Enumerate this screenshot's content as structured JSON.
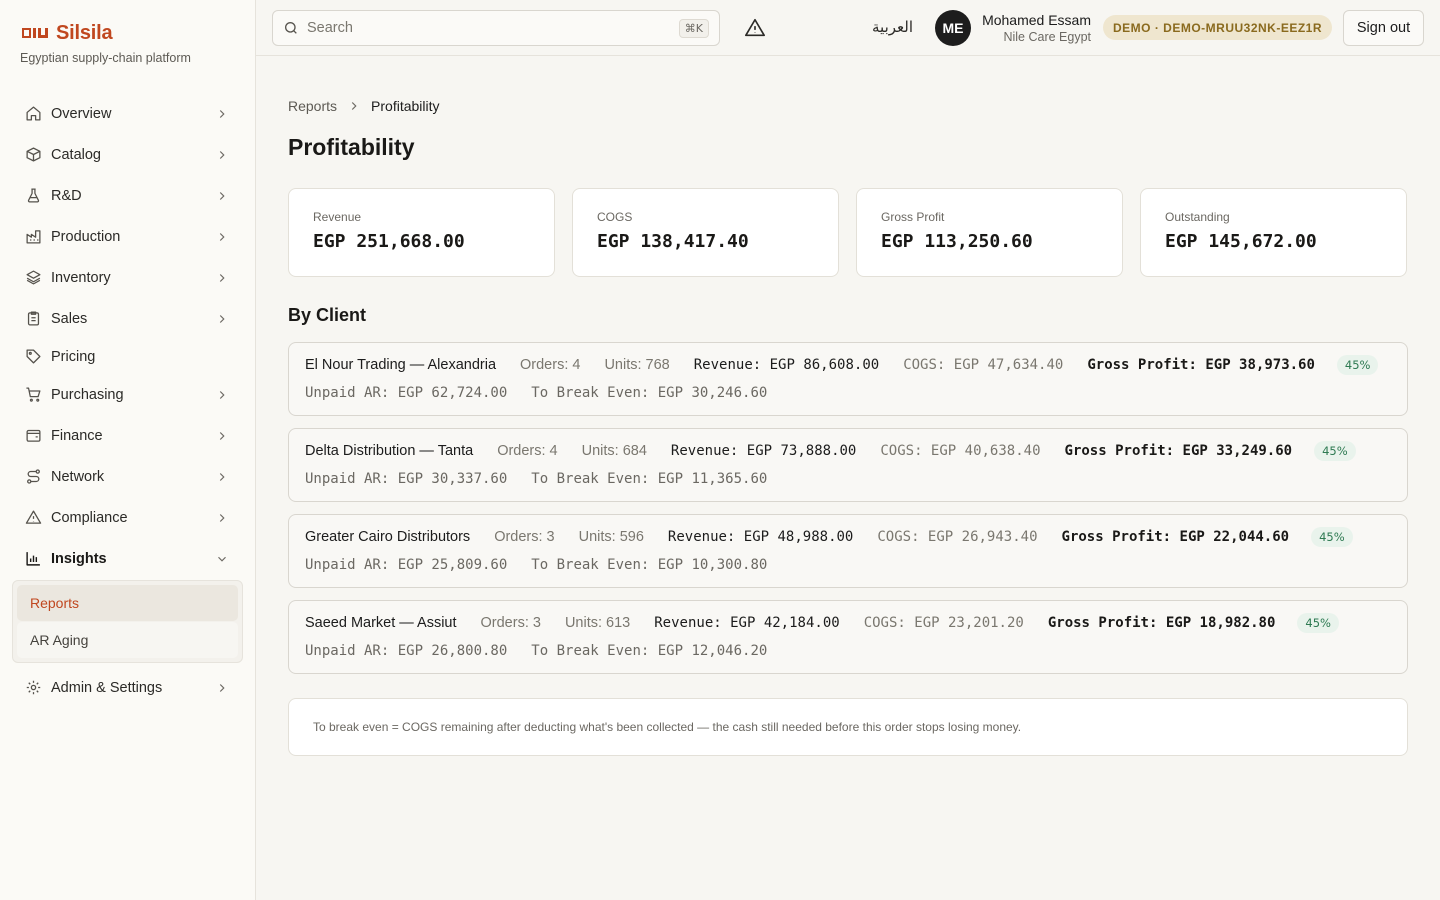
{
  "brand": {
    "name": "Silsila",
    "tagline": "Egyptian supply-chain platform",
    "color": "#c0471f"
  },
  "sidebar": {
    "items": [
      {
        "label": "Overview",
        "icon": "home-icon",
        "expandable": true
      },
      {
        "label": "Catalog",
        "icon": "box-icon",
        "expandable": true
      },
      {
        "label": "R&D",
        "icon": "flask-icon",
        "expandable": true
      },
      {
        "label": "Production",
        "icon": "factory-icon",
        "expandable": true
      },
      {
        "label": "Inventory",
        "icon": "layers-icon",
        "expandable": true
      },
      {
        "label": "Sales",
        "icon": "clipboard-icon",
        "expandable": true
      },
      {
        "label": "Pricing",
        "icon": "tag-icon",
        "expandable": false
      },
      {
        "label": "Purchasing",
        "icon": "cart-icon",
        "expandable": true
      },
      {
        "label": "Finance",
        "icon": "wallet-icon",
        "expandable": true
      },
      {
        "label": "Network",
        "icon": "route-icon",
        "expandable": true
      },
      {
        "label": "Compliance",
        "icon": "warning-icon",
        "expandable": true
      },
      {
        "label": "Insights",
        "icon": "bar-chart-icon",
        "expandable": true,
        "expanded": true,
        "children": [
          {
            "label": "Reports",
            "active": true
          },
          {
            "label": "AR Aging"
          }
        ]
      },
      {
        "label": "Admin & Settings",
        "icon": "gear-icon",
        "expandable": true
      }
    ]
  },
  "topbar": {
    "search_placeholder": "Search",
    "search_shortcut": "⌘K",
    "language": "العربية",
    "user": {
      "initials": "ME",
      "name": "Mohamed Essam",
      "org": "Nile Care Egypt"
    },
    "demo_badge": "DEMO · DEMO-MRUU32NK-EEZ1R",
    "signout_label": "Sign out"
  },
  "breadcrumb": {
    "parent": "Reports",
    "current": "Profitability"
  },
  "page_title": "Profitability",
  "kpis": [
    {
      "label": "Revenue",
      "value": "EGP 251,668.00"
    },
    {
      "label": "COGS",
      "value": "EGP 138,417.40"
    },
    {
      "label": "Gross Profit",
      "value": "EGP 113,250.60"
    },
    {
      "label": "Outstanding",
      "value": "EGP 145,672.00"
    }
  ],
  "section_title": "By Client",
  "clients": [
    {
      "name": "El Nour Trading — Alexandria",
      "orders": "Orders: 4",
      "units": "Units: 768",
      "revenue": "Revenue: EGP 86,608.00",
      "cogs": "COGS: EGP 47,634.40",
      "gross_profit": "Gross Profit: EGP 38,973.60",
      "margin": "45%",
      "unpaid_ar": "Unpaid AR: EGP 62,724.00",
      "break_even": "To Break Even: EGP 30,246.60"
    },
    {
      "name": "Delta Distribution — Tanta",
      "orders": "Orders: 4",
      "units": "Units: 684",
      "revenue": "Revenue: EGP 73,888.00",
      "cogs": "COGS: EGP 40,638.40",
      "gross_profit": "Gross Profit: EGP 33,249.60",
      "margin": "45%",
      "unpaid_ar": "Unpaid AR: EGP 30,337.60",
      "break_even": "To Break Even: EGP 11,365.60"
    },
    {
      "name": "Greater Cairo Distributors",
      "orders": "Orders: 3",
      "units": "Units: 596",
      "revenue": "Revenue: EGP 48,988.00",
      "cogs": "COGS: EGP 26,943.40",
      "gross_profit": "Gross Profit: EGP 22,044.60",
      "margin": "45%",
      "unpaid_ar": "Unpaid AR: EGP 25,809.60",
      "break_even": "To Break Even: EGP 10,300.80"
    },
    {
      "name": "Saeed Market — Assiut",
      "orders": "Orders: 3",
      "units": "Units: 613",
      "revenue": "Revenue: EGP 42,184.00",
      "cogs": "COGS: EGP 23,201.20",
      "gross_profit": "Gross Profit: EGP 18,982.80",
      "margin": "45%",
      "unpaid_ar": "Unpaid AR: EGP 26,800.80",
      "break_even": "To Break Even: EGP 12,046.20"
    }
  ],
  "footnote": "To break even = COGS remaining after deducting what's been collected — the cash still needed before this order stops losing money."
}
